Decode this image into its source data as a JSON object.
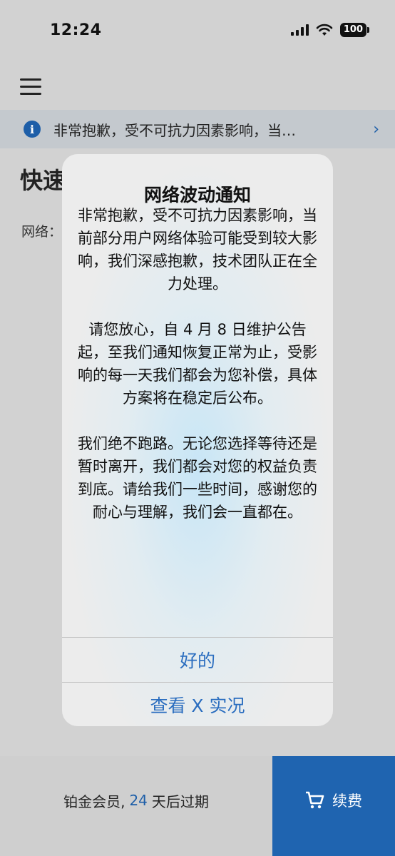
{
  "status_bar": {
    "time": "12:24",
    "battery": "100"
  },
  "banner": {
    "text": "非常抱歉，受不可抗力因素影响，当…"
  },
  "page": {
    "title": "快速",
    "network_label": "网络："
  },
  "dialog": {
    "title": "网络波动通知",
    "paragraphs": [
      "非常抱歉，受不可抗力因素影响，当前部分用户网络体验可能受到较大影响，我们深感抱歉，技术团队正在全力处理。",
      "请您放心，自 4 月 8 日维护公告起，至我们通知恢复正常为止，受影响的每一天我们都会为您补偿，具体方案将在稳定后公布。",
      "我们绝不跑路。无论您选择等待还是暂时离开，我们都会对您的权益负责到底。请给我们一些时间，感谢您的耐心与理解，我们会一直都在。"
    ],
    "ok_label": "好的",
    "x_label": "查看 X 实况"
  },
  "bottom_bar": {
    "member_prefix": "铂金会员,",
    "member_days": "24",
    "member_suffix": "天后过期",
    "renew_label": "续费"
  },
  "colors": {
    "accent": "#1f64b0",
    "link": "#2a6dbf"
  },
  "icons": [
    "signal-icon",
    "wifi-icon",
    "battery-icon",
    "menu-icon",
    "info-icon",
    "chevron-right-icon",
    "cart-icon"
  ]
}
